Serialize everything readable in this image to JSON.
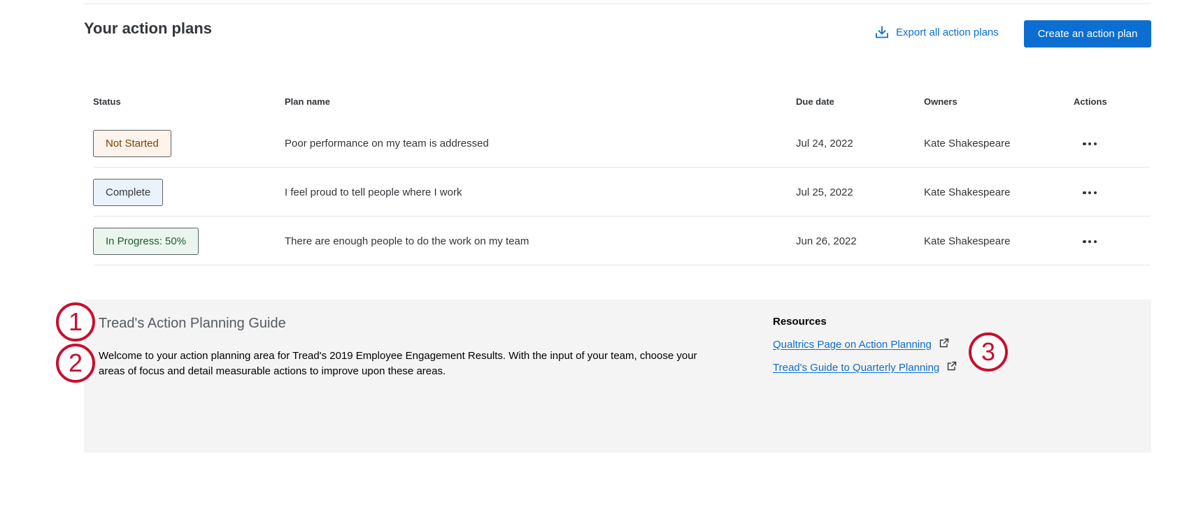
{
  "header": {
    "title": "Your action plans",
    "export_label": "Export all action plans",
    "create_label": "Create an action plan"
  },
  "table": {
    "columns": [
      "Status",
      "Plan name",
      "Due date",
      "Owners",
      "Actions"
    ],
    "rows": [
      {
        "status": "Not Started",
        "plan": "Poor performance on my team is addressed",
        "due": "Jul 24, 2022",
        "owner": "Kate Shakespeare"
      },
      {
        "status": "Complete",
        "plan": "I feel proud to tell people where I work",
        "due": "Jul 25, 2022",
        "owner": "Kate Shakespeare"
      },
      {
        "status": "In Progress: 50%",
        "plan": "There are enough people to do the work on my team",
        "due": "Jun 26, 2022",
        "owner": "Kate Shakespeare"
      }
    ]
  },
  "guide": {
    "title": "Tread's Action Planning Guide",
    "body": "Welcome to your action planning area for Tread's 2019 Employee Engagement Results. With the input of your team, choose your areas of focus and detail measurable actions to improve upon these areas."
  },
  "resources": {
    "title": "Resources",
    "links": [
      "Qualtrics Page on Action Planning",
      "Tread's Guide to Quarterly Planning"
    ]
  },
  "callouts": [
    "1",
    "2",
    "3"
  ],
  "colors": {
    "accent": "#0b6ed0",
    "callout": "#c8102e",
    "panel": "#f4f4f4"
  }
}
